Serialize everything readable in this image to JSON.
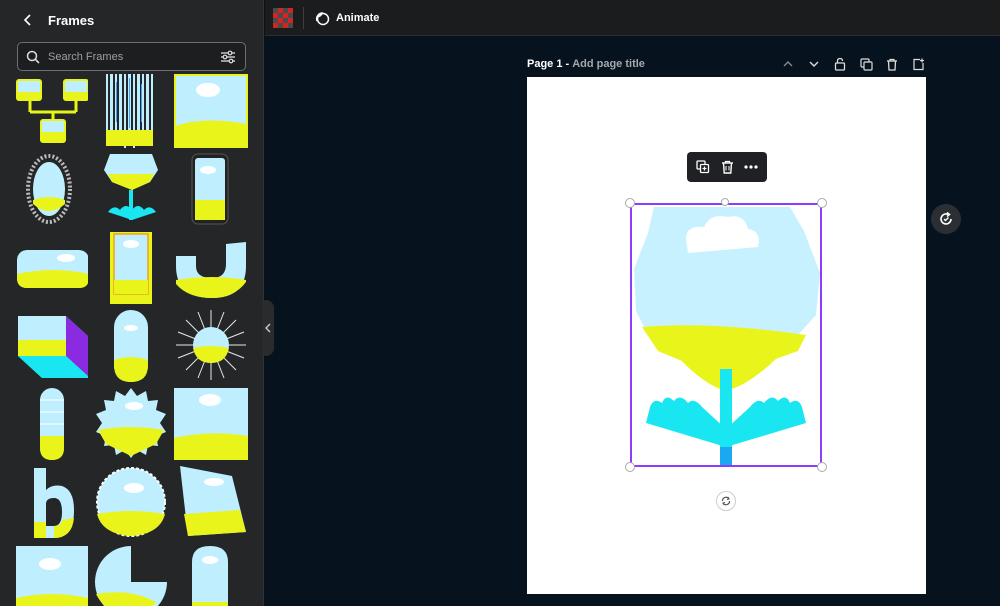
{
  "panel": {
    "title": "Frames",
    "search_placeholder": "Search Frames"
  },
  "topbar": {
    "animate_label": "Animate"
  },
  "page": {
    "label": "Page 1 -",
    "title_placeholder": "Add page title"
  },
  "colors": {
    "sky": "#bfefff",
    "grass": "#e9f51a",
    "cyan": "#19e6f0",
    "purple": "#8a2be2",
    "selection": "#8b3dff"
  },
  "icons": [
    "chevron-left-icon",
    "search-icon",
    "sliders-icon",
    "checkerboard-icon",
    "animate-icon",
    "chevron-up-icon",
    "chevron-down-icon",
    "lock-icon",
    "duplicate-icon",
    "trash-icon",
    "add-page-icon",
    "more-icon",
    "rotate-icon",
    "refresh-icon",
    "collapse-chevron-icon"
  ]
}
